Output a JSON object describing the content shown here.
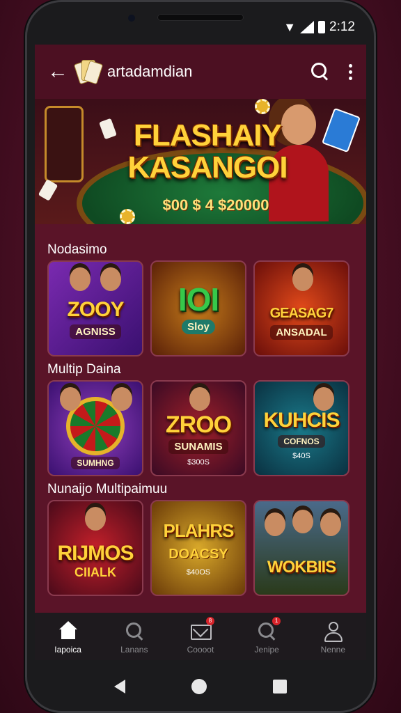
{
  "status_bar": {
    "time": "2:12"
  },
  "appbar": {
    "back_icon": "arrow-left-icon",
    "logo_icon": "playing-cards-icon",
    "title": "artadamdian",
    "search_icon": "search-icon",
    "more_icon": "more-vertical-icon"
  },
  "banner": {
    "title": "FLASHAIY KASANGOI",
    "amount": "$00 $ 4 $20000"
  },
  "sections": [
    {
      "label": "Nodasimo",
      "tiles": [
        {
          "title": "ZOOY",
          "sub": "AGNISS",
          "foot": ""
        },
        {
          "title": "IOI",
          "sub": "Sloy",
          "foot": ""
        },
        {
          "title": "GEASAG7",
          "sub": "ANSADAL",
          "foot": ""
        }
      ]
    },
    {
      "label": "Multip Daina",
      "tiles": [
        {
          "title": "",
          "sub": "SUMHNG",
          "foot": ""
        },
        {
          "title": "ZROO",
          "sub": "SUNAMIS",
          "foot": "$300S"
        },
        {
          "title": "KUHCIS",
          "sub": "COFNOS",
          "foot": "$40S"
        }
      ]
    },
    {
      "label": "Nunaijo Multipaimuu",
      "tiles": [
        {
          "title": "RIJMOS",
          "sub": "CIIALK",
          "foot": ""
        },
        {
          "title": "PLAHRS",
          "sub": "DOACSY",
          "foot": "$40OS"
        },
        {
          "title": "WOKBIIS",
          "sub": "",
          "foot": ""
        }
      ]
    }
  ],
  "bottom_nav": [
    {
      "label": "Iapoica",
      "icon": "home-icon",
      "active": true
    },
    {
      "label": "Lanans",
      "icon": "search-icon",
      "active": false
    },
    {
      "label": "Coooot",
      "icon": "mail-icon",
      "active": false,
      "badge": "8"
    },
    {
      "label": "Jenipe",
      "icon": "search-icon",
      "active": false,
      "badge": "1"
    },
    {
      "label": "Nenne",
      "icon": "user-icon",
      "active": false
    }
  ],
  "colors": {
    "accent": "#ffd23a",
    "screen_bg": "#5a1428",
    "appbar_bg": "#4c1022",
    "nav_bg": "#1e1a1e"
  }
}
